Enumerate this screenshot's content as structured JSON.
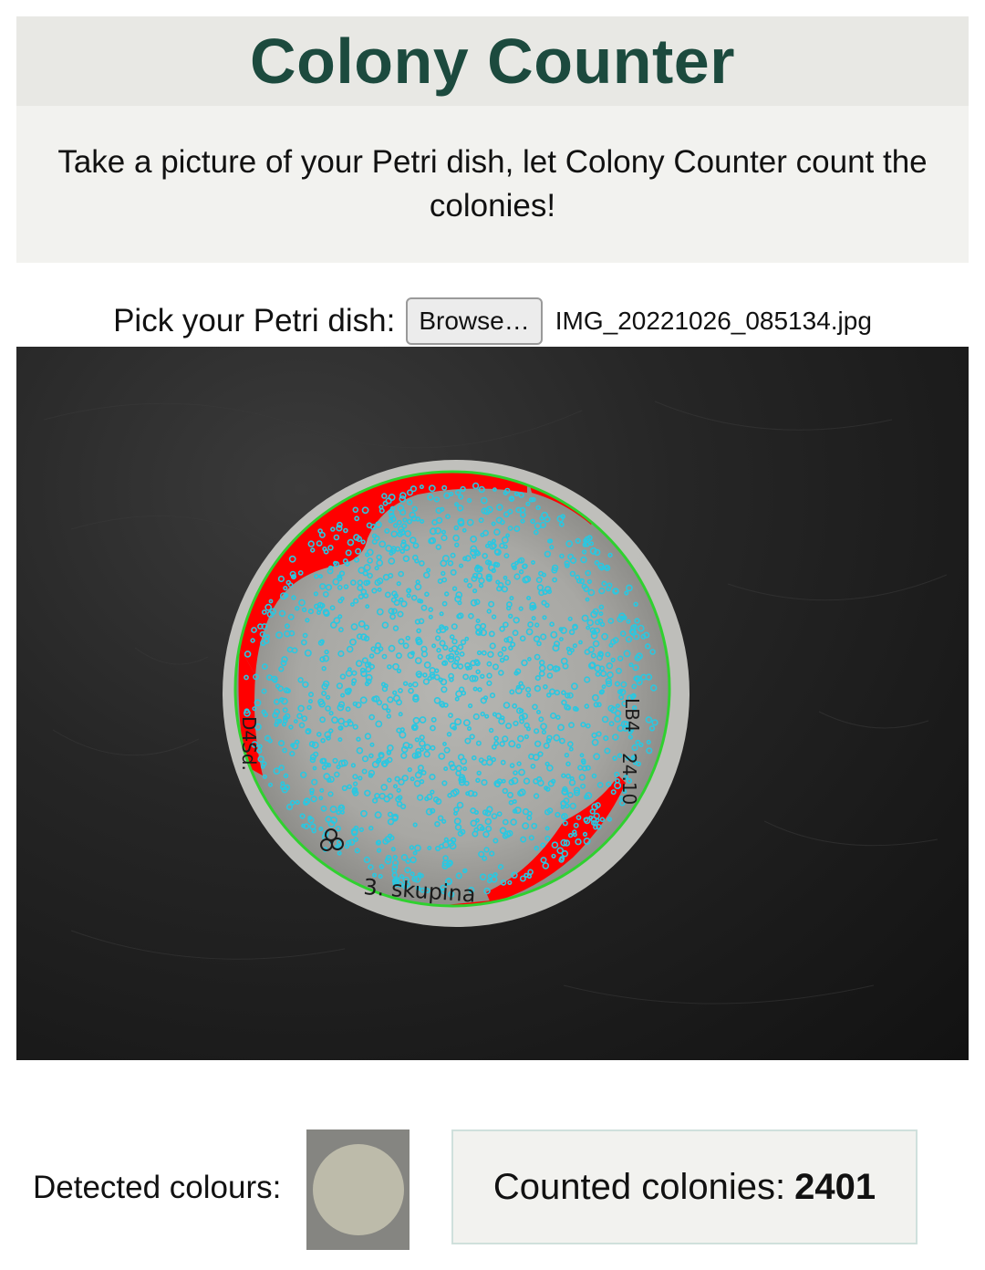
{
  "header": {
    "title": "Colony Counter",
    "subtitle": "Take a picture of your Petri dish, let Colony Counter count the colonies!"
  },
  "picker": {
    "label": "Pick your Petri dish:",
    "button_label": "Browse…",
    "file_name": "IMG_20221026_085134.jpg"
  },
  "dish_image": {
    "handwriting": [
      "3. skupina",
      "LB4",
      "24.10",
      "D4Sd."
    ]
  },
  "colours": {
    "accent_title": "#1c4a3e",
    "rim": "#2fd12f",
    "overlay_red": "#ff0000",
    "colony_marker": "#2bc7e0",
    "detected_colour": "#bdbbaa"
  },
  "results": {
    "detected_label": "Detected colours:",
    "count_label": "Counted colonies:",
    "count_value": "2401"
  }
}
